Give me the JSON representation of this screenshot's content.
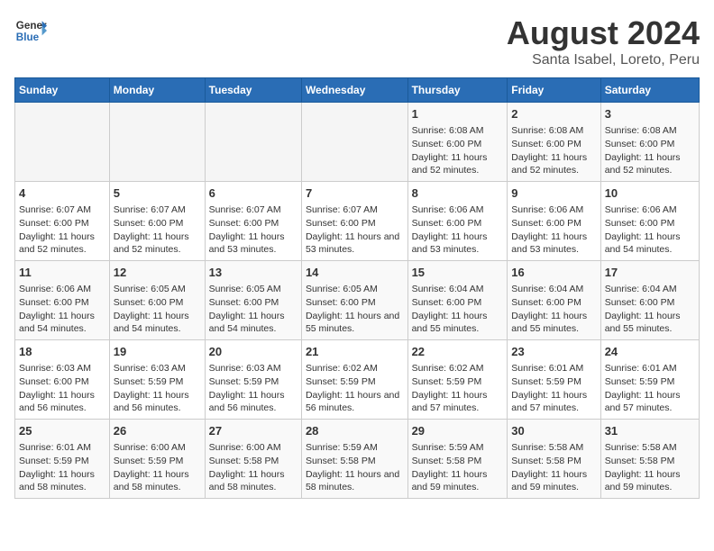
{
  "header": {
    "logo_general": "General",
    "logo_blue": "Blue",
    "main_title": "August 2024",
    "subtitle": "Santa Isabel, Loreto, Peru"
  },
  "weekdays": [
    "Sunday",
    "Monday",
    "Tuesday",
    "Wednesday",
    "Thursday",
    "Friday",
    "Saturday"
  ],
  "weeks": [
    [
      {
        "day": "",
        "empty": true
      },
      {
        "day": "",
        "empty": true
      },
      {
        "day": "",
        "empty": true
      },
      {
        "day": "",
        "empty": true
      },
      {
        "day": "1",
        "sunrise": "6:08 AM",
        "sunset": "6:00 PM",
        "daylight": "11 hours and 52 minutes."
      },
      {
        "day": "2",
        "sunrise": "6:08 AM",
        "sunset": "6:00 PM",
        "daylight": "11 hours and 52 minutes."
      },
      {
        "day": "3",
        "sunrise": "6:08 AM",
        "sunset": "6:00 PM",
        "daylight": "11 hours and 52 minutes."
      }
    ],
    [
      {
        "day": "4",
        "sunrise": "6:07 AM",
        "sunset": "6:00 PM",
        "daylight": "11 hours and 52 minutes."
      },
      {
        "day": "5",
        "sunrise": "6:07 AM",
        "sunset": "6:00 PM",
        "daylight": "11 hours and 52 minutes."
      },
      {
        "day": "6",
        "sunrise": "6:07 AM",
        "sunset": "6:00 PM",
        "daylight": "11 hours and 53 minutes."
      },
      {
        "day": "7",
        "sunrise": "6:07 AM",
        "sunset": "6:00 PM",
        "daylight": "11 hours and 53 minutes."
      },
      {
        "day": "8",
        "sunrise": "6:06 AM",
        "sunset": "6:00 PM",
        "daylight": "11 hours and 53 minutes."
      },
      {
        "day": "9",
        "sunrise": "6:06 AM",
        "sunset": "6:00 PM",
        "daylight": "11 hours and 53 minutes."
      },
      {
        "day": "10",
        "sunrise": "6:06 AM",
        "sunset": "6:00 PM",
        "daylight": "11 hours and 54 minutes."
      }
    ],
    [
      {
        "day": "11",
        "sunrise": "6:06 AM",
        "sunset": "6:00 PM",
        "daylight": "11 hours and 54 minutes."
      },
      {
        "day": "12",
        "sunrise": "6:05 AM",
        "sunset": "6:00 PM",
        "daylight": "11 hours and 54 minutes."
      },
      {
        "day": "13",
        "sunrise": "6:05 AM",
        "sunset": "6:00 PM",
        "daylight": "11 hours and 54 minutes."
      },
      {
        "day": "14",
        "sunrise": "6:05 AM",
        "sunset": "6:00 PM",
        "daylight": "11 hours and 55 minutes."
      },
      {
        "day": "15",
        "sunrise": "6:04 AM",
        "sunset": "6:00 PM",
        "daylight": "11 hours and 55 minutes."
      },
      {
        "day": "16",
        "sunrise": "6:04 AM",
        "sunset": "6:00 PM",
        "daylight": "11 hours and 55 minutes."
      },
      {
        "day": "17",
        "sunrise": "6:04 AM",
        "sunset": "6:00 PM",
        "daylight": "11 hours and 55 minutes."
      }
    ],
    [
      {
        "day": "18",
        "sunrise": "6:03 AM",
        "sunset": "6:00 PM",
        "daylight": "11 hours and 56 minutes."
      },
      {
        "day": "19",
        "sunrise": "6:03 AM",
        "sunset": "5:59 PM",
        "daylight": "11 hours and 56 minutes."
      },
      {
        "day": "20",
        "sunrise": "6:03 AM",
        "sunset": "5:59 PM",
        "daylight": "11 hours and 56 minutes."
      },
      {
        "day": "21",
        "sunrise": "6:02 AM",
        "sunset": "5:59 PM",
        "daylight": "11 hours and 56 minutes."
      },
      {
        "day": "22",
        "sunrise": "6:02 AM",
        "sunset": "5:59 PM",
        "daylight": "11 hours and 57 minutes."
      },
      {
        "day": "23",
        "sunrise": "6:01 AM",
        "sunset": "5:59 PM",
        "daylight": "11 hours and 57 minutes."
      },
      {
        "day": "24",
        "sunrise": "6:01 AM",
        "sunset": "5:59 PM",
        "daylight": "11 hours and 57 minutes."
      }
    ],
    [
      {
        "day": "25",
        "sunrise": "6:01 AM",
        "sunset": "5:59 PM",
        "daylight": "11 hours and 58 minutes."
      },
      {
        "day": "26",
        "sunrise": "6:00 AM",
        "sunset": "5:59 PM",
        "daylight": "11 hours and 58 minutes."
      },
      {
        "day": "27",
        "sunrise": "6:00 AM",
        "sunset": "5:58 PM",
        "daylight": "11 hours and 58 minutes."
      },
      {
        "day": "28",
        "sunrise": "5:59 AM",
        "sunset": "5:58 PM",
        "daylight": "11 hours and 58 minutes."
      },
      {
        "day": "29",
        "sunrise": "5:59 AM",
        "sunset": "5:58 PM",
        "daylight": "11 hours and 59 minutes."
      },
      {
        "day": "30",
        "sunrise": "5:58 AM",
        "sunset": "5:58 PM",
        "daylight": "11 hours and 59 minutes."
      },
      {
        "day": "31",
        "sunrise": "5:58 AM",
        "sunset": "5:58 PM",
        "daylight": "11 hours and 59 minutes."
      }
    ]
  ]
}
